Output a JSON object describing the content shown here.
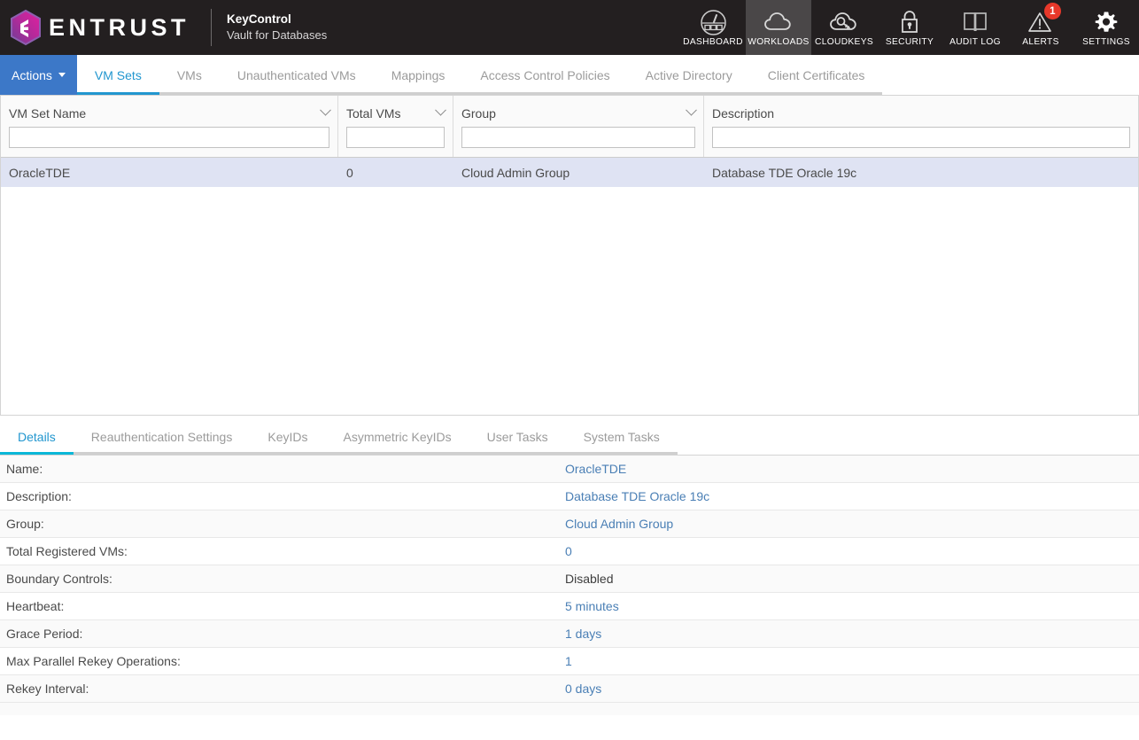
{
  "header": {
    "brand_word": "ENTRUST",
    "product_line1": "KeyControl",
    "product_line2": "Vault for Databases",
    "nav": [
      {
        "label": "DASHBOARD",
        "icon": "gauge-icon",
        "active": false,
        "badge": null
      },
      {
        "label": "WORKLOADS",
        "icon": "cloud-icon",
        "active": true,
        "badge": null
      },
      {
        "label": "CLOUDKEYS",
        "icon": "cloud-key-icon",
        "active": false,
        "badge": null
      },
      {
        "label": "SECURITY",
        "icon": "lock-icon",
        "active": false,
        "badge": null
      },
      {
        "label": "AUDIT LOG",
        "icon": "book-icon",
        "active": false,
        "badge": null
      },
      {
        "label": "ALERTS",
        "icon": "warning-triangle-icon",
        "active": false,
        "badge": "1"
      },
      {
        "label": "SETTINGS",
        "icon": "gear-icon",
        "active": false,
        "badge": null
      }
    ]
  },
  "toolbar": {
    "actions_label": "Actions",
    "tabs": [
      {
        "label": "VM Sets",
        "active": true
      },
      {
        "label": "VMs",
        "active": false
      },
      {
        "label": "Unauthenticated VMs",
        "active": false
      },
      {
        "label": "Mappings",
        "active": false
      },
      {
        "label": "Access Control Policies",
        "active": false
      },
      {
        "label": "Active Directory",
        "active": false
      },
      {
        "label": "Client Certificates",
        "active": false
      }
    ]
  },
  "grid": {
    "columns": [
      {
        "title": "VM Set Name",
        "filter_value": "",
        "sortable": true
      },
      {
        "title": "Total VMs",
        "filter_value": "",
        "sortable": true
      },
      {
        "title": "Group",
        "filter_value": "",
        "sortable": true
      },
      {
        "title": "Description",
        "filter_value": "",
        "sortable": false
      }
    ],
    "rows": [
      {
        "vm_set_name": "OracleTDE",
        "total_vms": "0",
        "group": "Cloud Admin Group",
        "description": "Database TDE Oracle 19c",
        "selected": true
      }
    ]
  },
  "detail_tabs": [
    {
      "label": "Details",
      "active": true
    },
    {
      "label": "Reauthentication Settings",
      "active": false
    },
    {
      "label": "KeyIDs",
      "active": false
    },
    {
      "label": "Asymmetric KeyIDs",
      "active": false
    },
    {
      "label": "User Tasks",
      "active": false
    },
    {
      "label": "System Tasks",
      "active": false
    }
  ],
  "details": [
    {
      "key": "Name:",
      "value": "OracleTDE",
      "link": true
    },
    {
      "key": "Description:",
      "value": "Database TDE Oracle 19c",
      "link": true
    },
    {
      "key": "Group:",
      "value": "Cloud Admin Group",
      "link": true
    },
    {
      "key": "Total Registered VMs:",
      "value": "0",
      "link": true
    },
    {
      "key": "Boundary Controls:",
      "value": "Disabled",
      "link": false
    },
    {
      "key": "Heartbeat:",
      "value": "5 minutes",
      "link": true
    },
    {
      "key": "Grace Period:",
      "value": "1 days",
      "link": true
    },
    {
      "key": "Max Parallel Rekey Operations:",
      "value": "1",
      "link": true
    },
    {
      "key": "Rekey Interval:",
      "value": "0 days",
      "link": true
    }
  ],
  "colors": {
    "topbar_bg": "#231f20",
    "accent_blue": "#2196cf",
    "actions_blue": "#3c78c8",
    "selected_row": "#dfe3f3",
    "badge_red": "#e8382a",
    "link_blue": "#4a7fb5",
    "logo_magenta": "#d6219e",
    "logo_purple": "#7b3fa0"
  }
}
